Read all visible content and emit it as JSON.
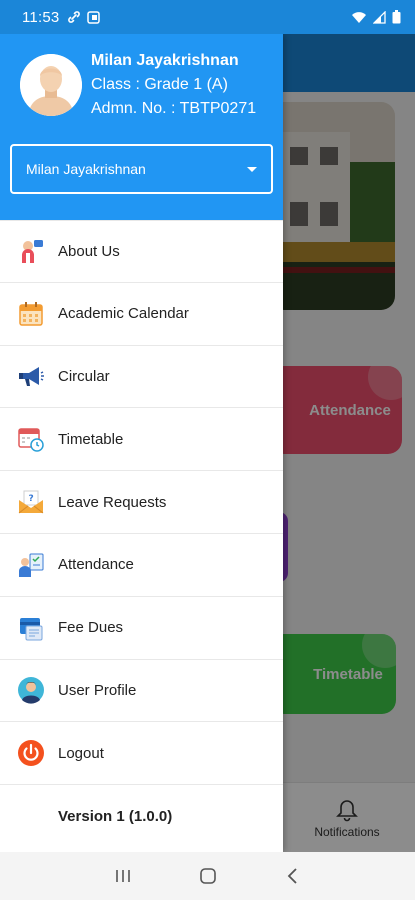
{
  "status_bar": {
    "time": "11:53"
  },
  "profile": {
    "name": "Milan Jayakrishnan",
    "class_text": "Class : Grade 1 (A)",
    "admission_text": "Admn. No. : TBTP0271"
  },
  "student_selector": {
    "selected": "Milan Jayakrishnan"
  },
  "menu": {
    "items": [
      {
        "label": "About Us",
        "icon": "about-us-icon"
      },
      {
        "label": "Academic Calendar",
        "icon": "calendar-icon"
      },
      {
        "label": "Circular",
        "icon": "megaphone-icon"
      },
      {
        "label": "Timetable",
        "icon": "timetable-icon"
      },
      {
        "label": "Leave Requests",
        "icon": "leave-request-icon"
      },
      {
        "label": "Attendance",
        "icon": "attendance-icon"
      },
      {
        "label": "Fee Dues",
        "icon": "fee-dues-icon"
      },
      {
        "label": "User Profile",
        "icon": "user-profile-icon"
      },
      {
        "label": "Logout",
        "icon": "power-icon"
      }
    ],
    "version": "Version 1 (1.0.0)"
  },
  "background": {
    "tiles": {
      "attendance": "Attendance",
      "timetable": "Timetable"
    },
    "bottom_nav": {
      "notifications": "Notifications"
    }
  },
  "colors": {
    "primary": "#2196f3",
    "status_bar": "#1b86d8",
    "logout_red": "#f4511e"
  }
}
